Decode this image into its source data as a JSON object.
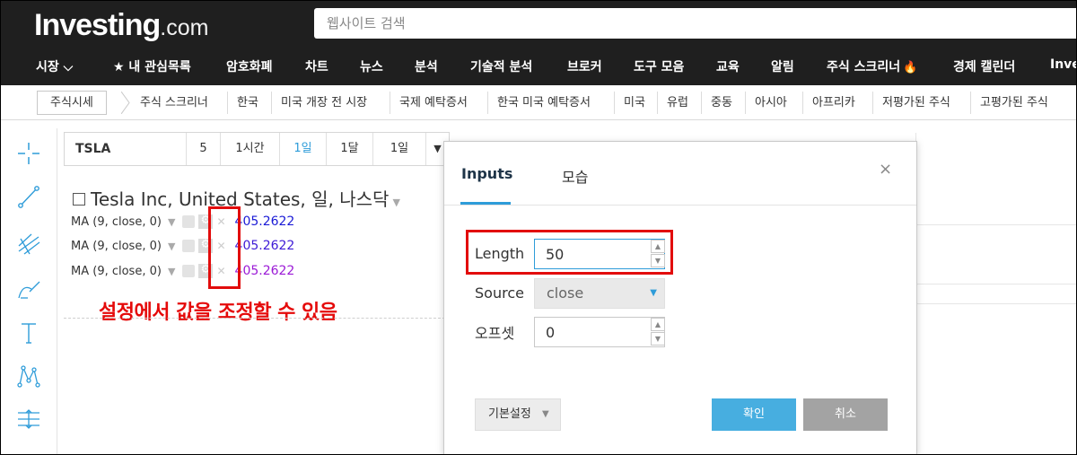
{
  "header": {
    "logo_main": "Investing",
    "logo_suffix": ".com",
    "search_placeholder": "웹사이트 검색",
    "nav": [
      "시장 ⌵",
      "★ 내 관심목록",
      "암호화폐",
      "차트",
      "뉴스",
      "분석",
      "기술적 분석",
      "브로커",
      "도구 모음",
      "교육",
      "알림",
      "주식 스크리너",
      "경제 캘린더",
      "Inve"
    ]
  },
  "breadcrumb": {
    "first": "주식시세",
    "items": [
      "주식 스크리너",
      "한국",
      "미국 개장 전 시장",
      "국제 예탁증서",
      "한국 미국 예탁증서",
      "미국",
      "유럽",
      "중동",
      "아시아",
      "아프리카",
      "저평가된 주식",
      "고평가된 주식"
    ]
  },
  "toolbar": {
    "symbol": "TSLA",
    "buttons": [
      "5",
      "1시간",
      "1일",
      "1달",
      "1일"
    ],
    "active_index": 2
  },
  "chart": {
    "title": "Tesla Inc, United States, 일, 나스닥",
    "ma_rows": [
      {
        "label": "MA (9, close, 0)",
        "value": "405.2622",
        "color": "#1a1ad6"
      },
      {
        "label": "MA (9, close, 0)",
        "value": "405.2622",
        "color": "#3d1ad6"
      },
      {
        "label": "MA (9, close, 0)",
        "value": "405.2622",
        "color": "#9b1ad6"
      }
    ],
    "annotation": "설정에서 값을 조정할 수 있음"
  },
  "dialog": {
    "tabs": [
      "Inputs",
      "모습"
    ],
    "length_label": "Length",
    "length_value": "50",
    "source_label": "Source",
    "source_value": "close",
    "offset_label": "오프셋",
    "offset_value": "0",
    "defaults_label": "기본설정",
    "ok_label": "확인",
    "cancel_label": "취소",
    "close_glyph": "×"
  },
  "colors": {
    "accent": "#2e9cd9",
    "highlight": "#e20c0c",
    "ok": "#47aee0",
    "cancel": "#a3a3a3"
  }
}
